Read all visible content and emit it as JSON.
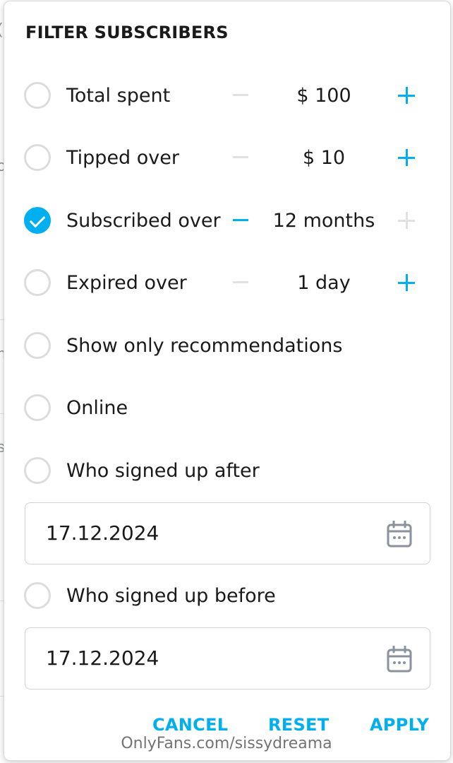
{
  "dialog": {
    "title": "FILTER SUBSCRIBERS",
    "options": [
      {
        "label": "Total spent",
        "checked": false,
        "value": "$ 100",
        "minus_enabled": false,
        "plus_enabled": true
      },
      {
        "label": "Tipped over",
        "checked": false,
        "value": "$ 10",
        "minus_enabled": false,
        "plus_enabled": true
      },
      {
        "label": "Subscribed over",
        "checked": true,
        "value": "12 months",
        "minus_enabled": true,
        "plus_enabled": false
      },
      {
        "label": "Expired over",
        "checked": false,
        "value": "1 day",
        "minus_enabled": false,
        "plus_enabled": true
      },
      {
        "label": "Show only recommendations",
        "checked": false
      },
      {
        "label": "Online",
        "checked": false
      },
      {
        "label": "Who signed up after",
        "checked": false
      },
      {
        "label": "Who signed up before",
        "checked": false
      }
    ],
    "signed_up_after_date": "17.12.2024",
    "signed_up_before_date": "17.12.2024",
    "actions": {
      "cancel": "CANCEL",
      "reset": "RESET",
      "apply": "APPLY"
    }
  },
  "watermark": "OnlyFans.com/sissydreama",
  "colors": {
    "accent": "#00aff0",
    "disabled": "#e1e1e1",
    "text": "#1a1a1a",
    "radio_border": "#dcdcdc"
  },
  "icons": {
    "calendar": "calendar-icon",
    "check": "check-icon",
    "minus": "minus-icon",
    "plus": "plus-icon"
  }
}
